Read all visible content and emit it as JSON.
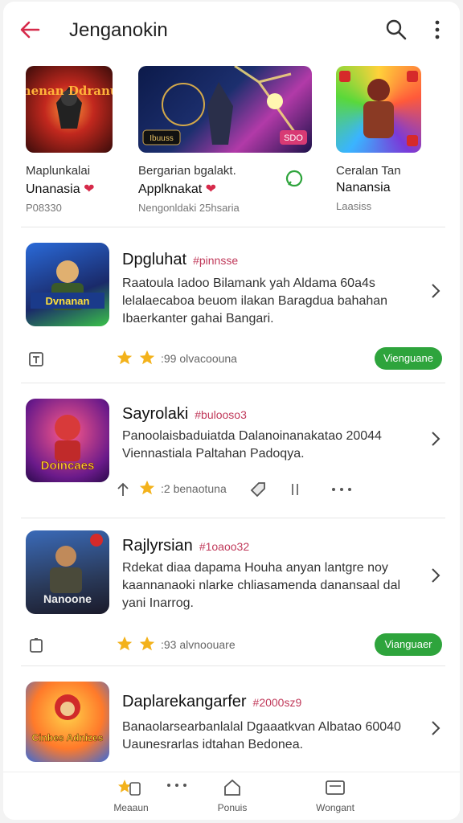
{
  "appbar": {
    "title": "Jenganokin"
  },
  "featured": [
    {
      "art": "Cenenan Ddranuse",
      "line1": "Maplunkalai",
      "line2": "Unanasia",
      "line3": "P08330"
    },
    {
      "art": "Ibuuss",
      "badge": "SDO",
      "line1": "Bergarian bgalakt.",
      "line2": "Applknakat",
      "line3": "Nengonldaki 25hsaria"
    },
    {
      "line1": "Ceralan Tan",
      "line2": "Nanansia",
      "line3": "Laasiss"
    }
  ],
  "items": [
    {
      "title": "Dpgluhat",
      "tag": "#pinnsse",
      "desc": "Raatoula Iadoo Bilamank yah Aldama 60a4s lelalaecaboa beuom ilakan Baragdua bahahan Ibaerkanter gahai Bangari.",
      "art": "Dvnanan",
      "rating": ":99",
      "rating_label": "olvacoouna",
      "button": "Vienguane"
    },
    {
      "title": "Sayrolaki",
      "tag": "#bulooso3",
      "desc": "Panoolaisbaduiatda Dalanoinanakatao 20044 Viennastiala Paltahan Padoqya.",
      "art": "Doincaes",
      "rating": ":2",
      "rating_label": "benaotuna"
    },
    {
      "title": "Rajlyrsian",
      "tag": "#1oaoo32",
      "desc": "Rdekat diaa dapama Houha anyan lantgre noy kaannanaoki nlarke chliasamenda danansaal dal yani Inarrog.",
      "art": "Nanoone",
      "rating": ":93",
      "rating_label": "alvnoouare",
      "button": "Vianguaer"
    },
    {
      "title": "Daplarekangarfer",
      "tag": "#2000sz9",
      "desc": "Banaolarsearbanlalal Dgaaatkvan Albatao 60040 Uaunesrarlas idtahan Bedonea.",
      "art": "Cinbes Adnizes"
    }
  ],
  "bottomnav": [
    {
      "label": "Meaaun"
    },
    {
      "label": "Ponuis"
    },
    {
      "label": "Wongant"
    }
  ],
  "colors": {
    "accent": "#d62a4a",
    "button": "#2ea43c",
    "star": "#f3b21b"
  }
}
